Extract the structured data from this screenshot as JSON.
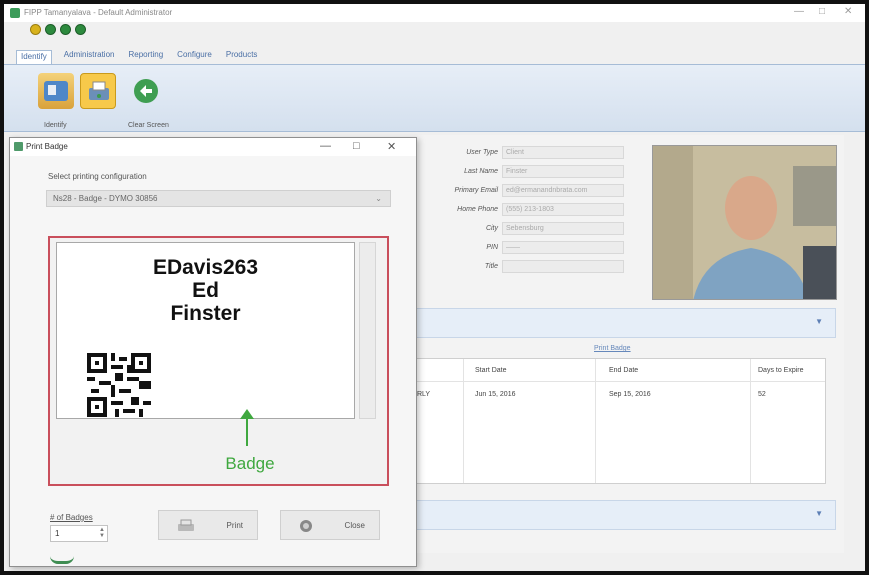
{
  "window": {
    "title": "FIPP Tamanyalava - Default Administrator",
    "minimize": "—",
    "maximize": "□",
    "close": "✕"
  },
  "ribbon_tabs": [
    "Identify",
    "Administration",
    "Reporting",
    "Configure",
    "Products"
  ],
  "ribbon_buttons": [
    {
      "label": "Identify",
      "icon": "id-card-icon"
    },
    {
      "label": "",
      "icon": "print-badge-icon"
    },
    {
      "label": "Clear Screen",
      "icon": "clear-screen-icon"
    }
  ],
  "user_fields": [
    {
      "label": "User Type",
      "value": "Client"
    },
    {
      "label": "Last Name",
      "value": "Finster"
    },
    {
      "label": "Primary Email",
      "value": "ed@ermanandnbrata.com"
    },
    {
      "label": "Home Phone",
      "value": "(555) 213-1803"
    },
    {
      "label": "City",
      "value": "Sebensburg"
    },
    {
      "label": "PIN",
      "value": "——"
    },
    {
      "label": "Title",
      "value": ""
    }
  ],
  "grid": {
    "link": "Print Badge",
    "columns": [
      "",
      "Start Date",
      "End Date",
      "Days to Expire"
    ],
    "rows": [
      [
        "RLY",
        "Jun 15, 2016",
        "Sep 15, 2016",
        "52"
      ]
    ]
  },
  "dialog": {
    "title": "Print Badge",
    "minimize": "—",
    "maximize": "□",
    "close": "✕",
    "config_label": "Select printing configuration",
    "config_value": "Ns28 - Badge - DYMO 30856",
    "config_arrow": "⌄",
    "badge": {
      "line1": "EDavis263",
      "line2": "Ed",
      "line3": "Finster"
    },
    "annotation": "Badge",
    "qty_label": "# of Badges",
    "qty_value": "1",
    "print_label": "Print",
    "close_label": "Close"
  },
  "colors": {
    "accent_green": "#3fa83f",
    "badge_border": "#c94f5c",
    "ribbon_bg": "#dce6f2"
  }
}
